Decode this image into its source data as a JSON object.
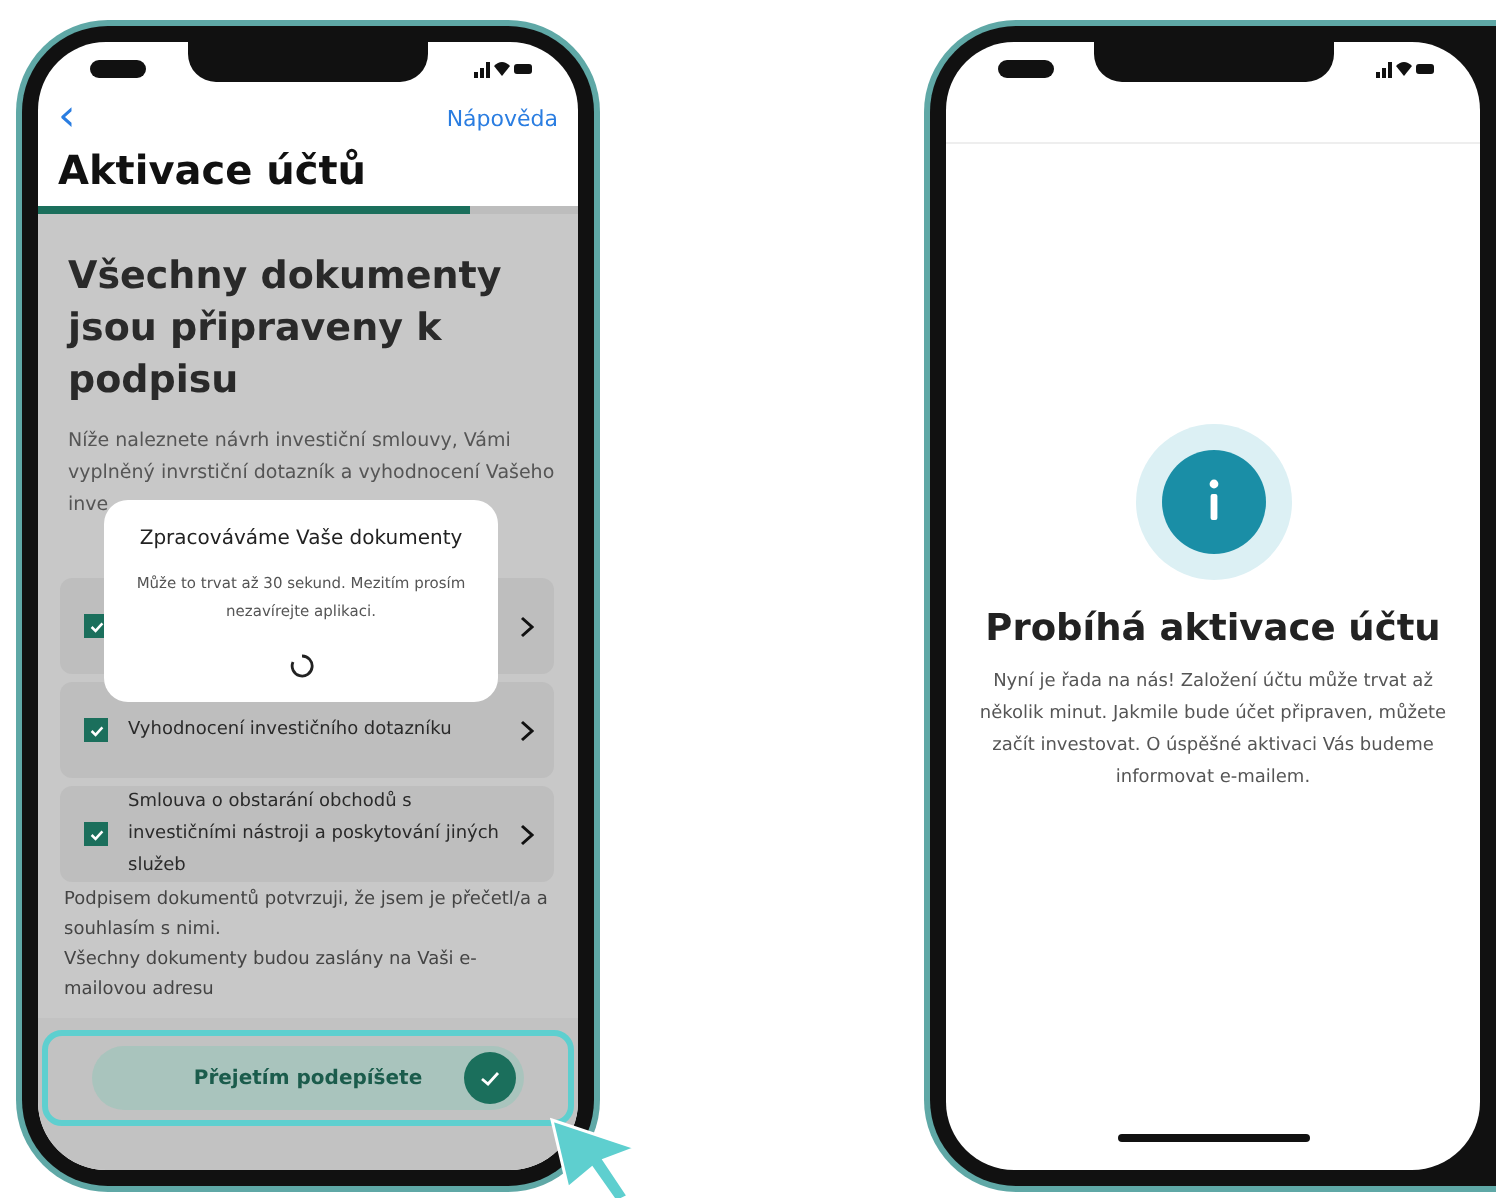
{
  "left_phone": {
    "nav": {
      "back": "‹",
      "help": "Nápověda"
    },
    "title": "Aktivace účtů",
    "progress": {
      "level": 0.8
    },
    "heading": "Všechny dokumenty jsou připraveny k podpisu",
    "description": "Níže naleznete návrh investiční smlouvy, Vámi vyplněný invrstiční dotazník a vyhodnocení Vašeho inve",
    "documents": [
      {
        "checked": true
      },
      {
        "label": "Vyhodnocení investičního dotazníku",
        "checked": true
      },
      {
        "label": "Smlouva o obstarání obchodů s investičními nástroji a poskytování jiných služeb",
        "checked": true
      }
    ],
    "consent": "Podpisem dokumentů potvrzuji, že jsem je přečetl/a a souhlasím s nimi.",
    "email_note": "Všechny dokumenty budou zaslány na Vaši e-mailovou adresu",
    "swipe_button": {
      "label": "Přejetím podepíšete"
    },
    "dialog": {
      "title": "Zpracováváme Vaše dokumenty",
      "message": "Může to trvat až 30 sekund. Mezitím prosím nezavírejte aplikaci."
    }
  },
  "right_phone": {
    "title": "Probíhá aktivace účtu",
    "message": "Nyní je řada na nás! Založení účtu může trvat až několik minut. Jakmile bude účet připraven, můžete začít investovat. O úspěšné aktivaci Vás budeme informovat e-mailem."
  }
}
